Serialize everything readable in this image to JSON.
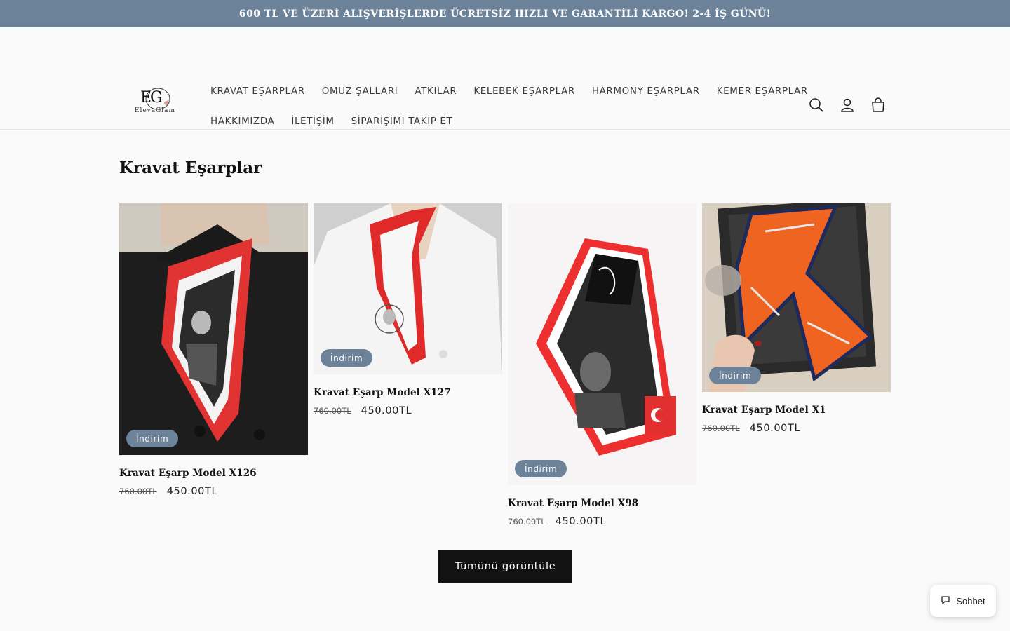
{
  "announcement": {
    "text": "600 TL VE ÜZERİ ALIŞVERİŞLERDE ÜCRETSİZ HIZLI VE GARANTİLİ KARGO! 2-4 İŞ GÜNÜ!"
  },
  "logo": {
    "initials": "EG",
    "wordmark": "ElevaGlam"
  },
  "nav": {
    "row1": [
      "KRAVAT EŞARPLAR",
      "OMUZ ŞALLARI",
      "ATKILAR",
      "KELEBEK EŞARPLAR",
      "HARMONY EŞARPLAR",
      "KEMER EŞARPLAR"
    ],
    "row2": [
      "HAKKIMIZDA",
      "İLETİŞİM",
      "SİPARİŞİMİ TAKİP ET"
    ]
  },
  "header_icons": [
    "search-icon",
    "account-icon",
    "cart-icon"
  ],
  "collection": {
    "title": "Kravat Eşarplar"
  },
  "products": [
    {
      "title": "Kravat Eşarp Model X126",
      "badge": "İndirim",
      "price_old": "760.00TL",
      "price_new": "450.00TL"
    },
    {
      "title": "Kravat Eşarp Model X127",
      "badge": "İndirim",
      "price_old": "760.00TL",
      "price_new": "450.00TL"
    },
    {
      "title": "Kravat Eşarp Model X98",
      "badge": "İndirim",
      "price_old": "760.00TL",
      "price_new": "450.00TL"
    },
    {
      "title": "Kravat Eşarp Model X1",
      "badge": "İndirim",
      "price_old": "760.00TL",
      "price_new": "450.00TL"
    }
  ],
  "view_all": {
    "label": "Tümünü görüntüle"
  },
  "chat": {
    "label": "Sohbet"
  },
  "colors": {
    "announcement_bg": "#6b8299",
    "badge_bg": "#6b8299",
    "button_bg": "#121212",
    "page_bg": "#fafafa"
  }
}
